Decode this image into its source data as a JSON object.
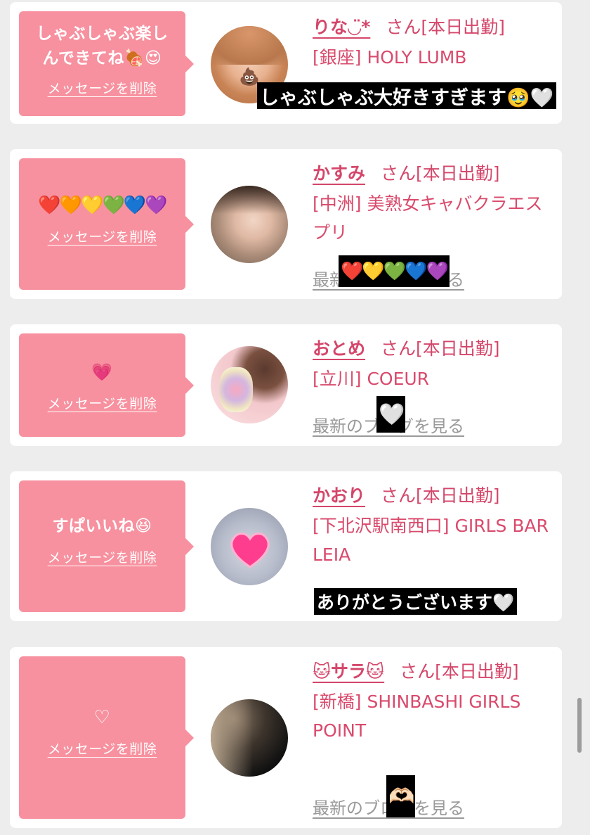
{
  "cards": [
    {
      "message": "しゃぶしゃぶ楽し\nんできてね🍖😍",
      "delete_label": "メッセージを削除",
      "name": "りな◡̈*",
      "honorific": "さん[本日出勤]",
      "shop": "[銀座] HOLY LUMB",
      "overlay_text": "しゃぶしゃぶ大好きすぎます🥹🤍",
      "avatar_emoji": "💩"
    },
    {
      "message": "❤️🧡💛💚💙💜",
      "delete_label": "メッセージを削除",
      "name": "かすみ",
      "honorific": "さん[本日出勤]",
      "shop": "[中洲] 美熟女キャバクラエスプリ",
      "blog_label": "最新のブログを見る",
      "overlay_text": "❤️💛💚💙💜"
    },
    {
      "message": "💗",
      "delete_label": "メッセージを削除",
      "name": "おとめ",
      "honorific": "さん[本日出勤]",
      "shop": "[立川] COEUR",
      "blog_label": "最新のブログを見る",
      "overlay_text": "🤍"
    },
    {
      "message": "すぱいいね😆",
      "delete_label": "メッセージを削除",
      "name": "かおり",
      "honorific": "さん[本日出勤]",
      "shop": "[下北沢駅南西口] GIRLS BAR LEIA",
      "overlay_text": "ありがとうございます🤍"
    },
    {
      "message": "♡",
      "delete_label": "メッセージを削除",
      "name": "🐱サラ🐱",
      "honorific": "さん[本日出勤]",
      "shop": "[新橋] SHINBASHI GIRLS POINT",
      "blog_label": "最新のブログを見る",
      "overlay_text": "🫶🏻"
    }
  ],
  "colors": {
    "page_background": "#ededed",
    "card_background": "#ffffff",
    "message_bubble": "#f7919f",
    "name_accent": "#d4466a",
    "blog_link": "#9a9a9a"
  },
  "icons": [
    "meat-emoji-icon",
    "heart-eyes-emoji-icon",
    "heart-emoji-icon",
    "cat-emoji-icon",
    "heart-hands-emoji-icon"
  ]
}
